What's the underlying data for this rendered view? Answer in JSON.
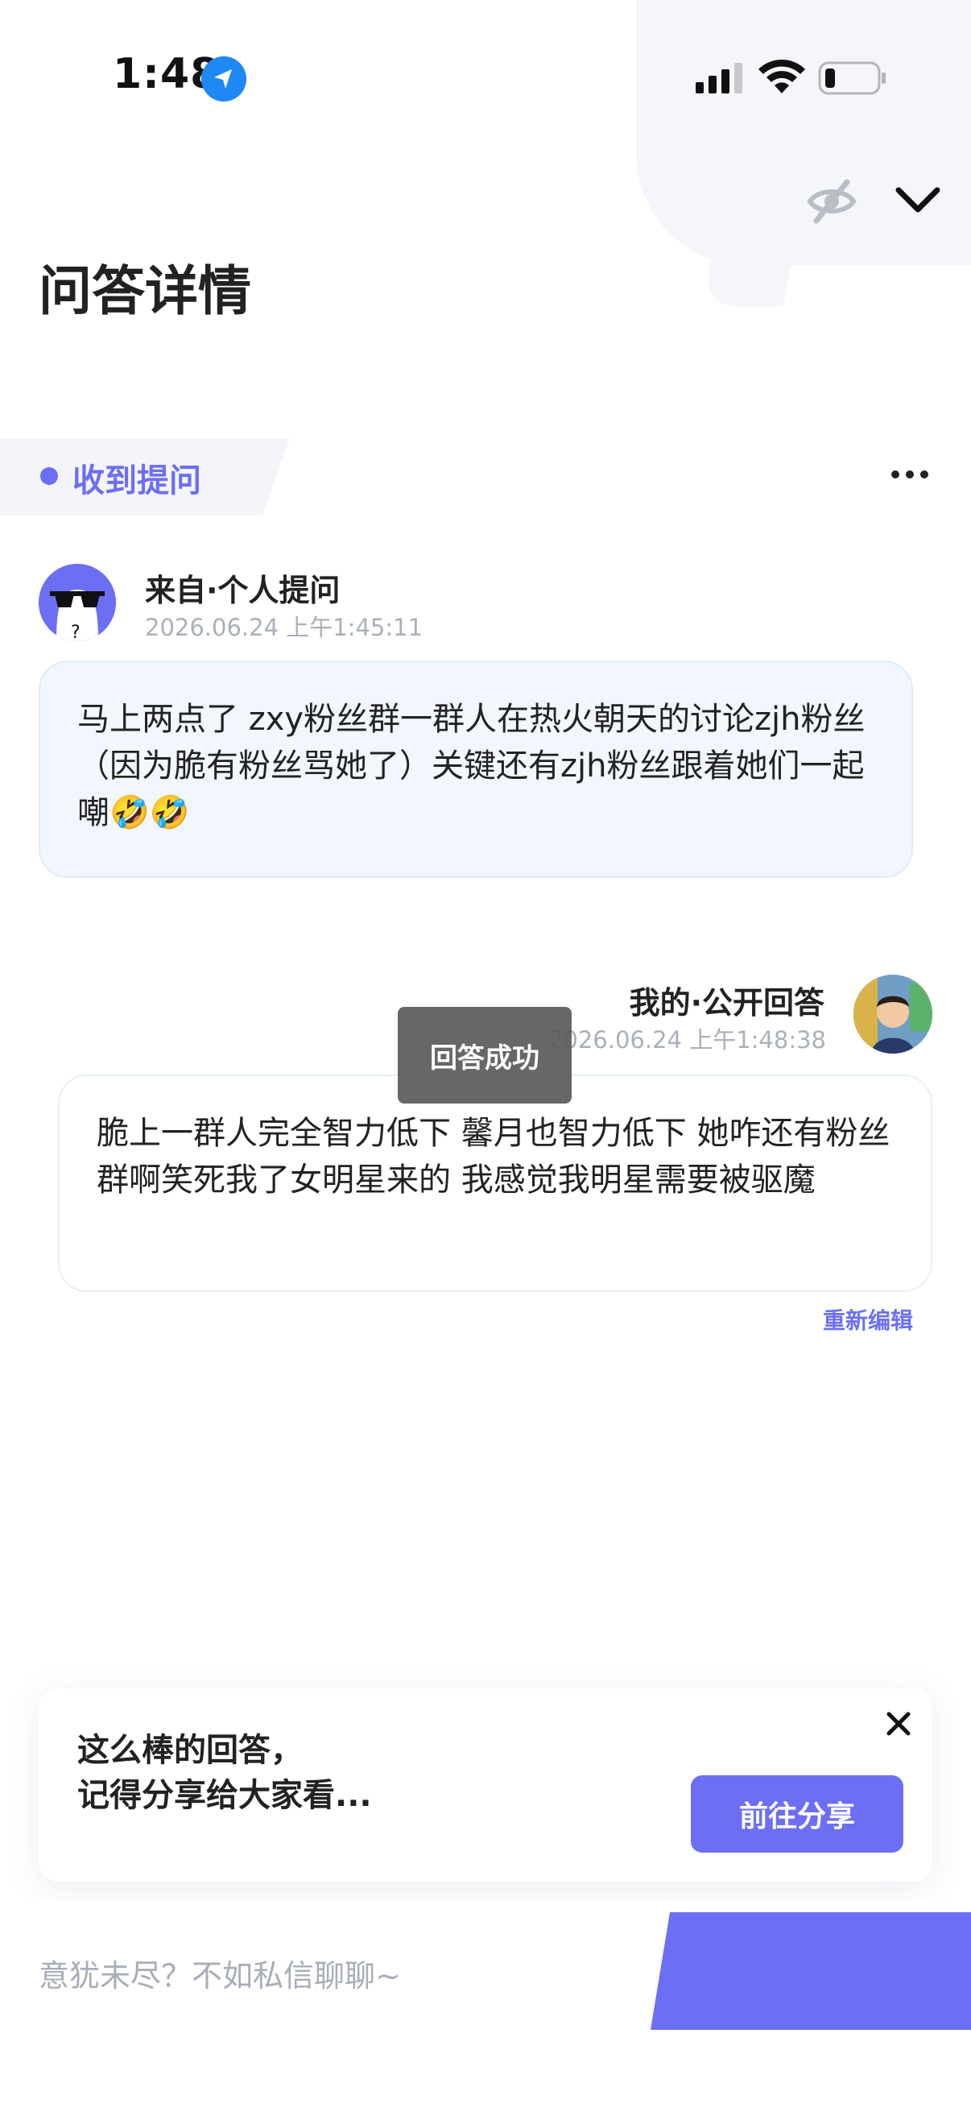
{
  "status_bar": {
    "time": "1:48"
  },
  "page": {
    "title": "问答详情"
  },
  "tag": {
    "label": "收到提问"
  },
  "question": {
    "source": "来自·个人提问",
    "time": "2026.06.24 上午1:45:11",
    "text": "马上两点了 zxy粉丝群一群人在热火朝天的讨论zjh粉丝 （因为脆有粉丝骂她了）关键还有zjh粉丝跟着她们一起嘲🤣🤣"
  },
  "answer": {
    "source": "我的·公开回答",
    "time": "2026.06.24 上午1:48:38",
    "text": "脆上一群人完全智力低下 馨月也智力低下 她咋还有粉丝群啊笑死我了女明星来的 我感觉我明星需要被驱魔",
    "reedit_label": "重新编辑"
  },
  "toast": {
    "text": "回答成功"
  },
  "share_card": {
    "line1": "这么棒的回答，",
    "line2": "记得分享给大家看...",
    "button_label": "前往分享"
  },
  "bottom": {
    "placeholder": "意犹未尽？不如私信聊聊~"
  },
  "colors": {
    "accent": "#6c6ff4",
    "bubble_bg": "#f2f6fd",
    "muted_text": "#aab0ba"
  }
}
